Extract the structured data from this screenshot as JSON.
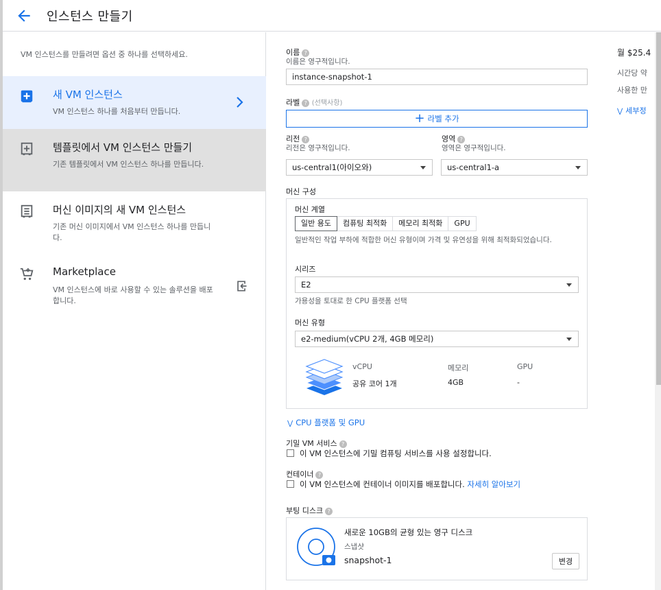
{
  "header": {
    "title": "인스턴스 만들기"
  },
  "left": {
    "intro": "VM 인스턴스를 만들려면 옵션 중 하나를 선택하세요.",
    "options": [
      {
        "title": "새 VM 인스턴스",
        "desc": "VM 인스턴스 하나를 처음부터 만듭니다."
      },
      {
        "title": "템플릿에서 VM 인스턴스 만들기",
        "desc": "기존 템플릿에서 VM 인스턴스 하나를 만듭니다."
      },
      {
        "title": "머신 이미지의 새 VM 인스턴스",
        "desc": "기존 머신 이미지에서 VM 인스턴스 하나를 만듭니다."
      },
      {
        "title": "Marketplace",
        "desc": "VM 인스턴스에 바로 사용할 수 있는 솔루션을 배포합니다."
      }
    ]
  },
  "form": {
    "name_label": "이름",
    "name_sub": "이름은 영구적입니다.",
    "name_value": "instance-snapshot-1",
    "labels_label": "라벨",
    "labels_optional": "(선택사항)",
    "add_label": "라벨 추가",
    "region_label": "리전",
    "region_sub": "리전은 영구적입니다.",
    "region_value": "us-central1(아이오와)",
    "zone_label": "영역",
    "zone_sub": "영역은 영구적입니다.",
    "zone_value": "us-central1-a",
    "machine_config": "머신 구성",
    "machine_family": "머신 계열",
    "tabs": [
      "일반 용도",
      "컴퓨팅 최적화",
      "메모리 최적화",
      "GPU"
    ],
    "family_desc": "일반적인 작업 부하에 적합한 머신 유형이며 가격 및 유연성을 위해 최적화되었습니다.",
    "series_label": "시리즈",
    "series_value": "E2",
    "series_sub": "가용성을 토대로 한 CPU 플랫폼 선택",
    "type_label": "머신 유형",
    "type_value": "e2-medium(vCPU 2개, 4GB 메모리)",
    "spec_headers": [
      "vCPU",
      "메모리",
      "GPU"
    ],
    "spec_values": [
      "공유 코어 1개",
      "4GB",
      "-"
    ],
    "cpu_link": "CPU 플랫폼 및 GPU",
    "confidential_label": "기밀 VM 서비스",
    "confidential_check": "이 VM 인스턴스에 기밀 컴퓨팅 서비스를 사용 설정합니다.",
    "container_label": "컨테이너",
    "container_check": "이 VM 인스턴스에 컨테이너 이미지를 배포합니다.",
    "learn_more": "자세히 알아보기",
    "boot_label": "부팅 디스크",
    "disk_title": "새로운 10GB의 균형 있는 영구 디스크",
    "disk_source_label": "스냅샷",
    "disk_source": "snapshot-1",
    "change": "변경"
  },
  "price": {
    "monthly": "월 $25.4",
    "hourly": "시간당 약",
    "usage": "사용한 만",
    "details": "세부정"
  },
  "colors": {
    "accent": "#1a73e8",
    "selected_bg": "#e8f0fe",
    "hover_bg": "#e0e0e0"
  }
}
